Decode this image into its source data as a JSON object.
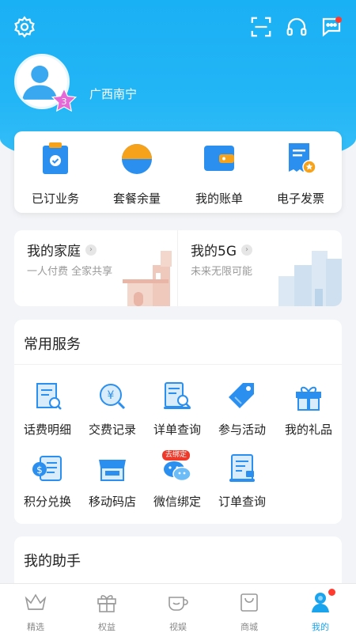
{
  "header": {
    "location": "广西南宁",
    "level": "3",
    "icons": [
      "gear-icon",
      "scan-icon",
      "headset-icon",
      "message-icon"
    ]
  },
  "quick_actions": [
    {
      "label": "已订业务",
      "icon": "clipboard-check-icon"
    },
    {
      "label": "套餐余量",
      "icon": "pie-chart-icon"
    },
    {
      "label": "我的账单",
      "icon": "wallet-icon"
    },
    {
      "label": "电子发票",
      "icon": "invoice-icon"
    }
  ],
  "family": {
    "left": {
      "title": "我的家庭",
      "subtitle": "一人付费 全家共享"
    },
    "right": {
      "title": "我的5G",
      "subtitle": "未来无限可能"
    }
  },
  "services": {
    "title": "常用服务",
    "items": [
      {
        "label": "话费明细",
        "icon": "bill-detail-icon"
      },
      {
        "label": "交费记录",
        "icon": "yuan-search-icon"
      },
      {
        "label": "详单查询",
        "icon": "document-search-icon"
      },
      {
        "label": "参与活动",
        "icon": "tag-icon"
      },
      {
        "label": "我的礼品",
        "icon": "gift-icon"
      },
      {
        "label": "积分兑换",
        "icon": "points-exchange-icon"
      },
      {
        "label": "移动码店",
        "icon": "store-icon"
      },
      {
        "label": "微信绑定",
        "icon": "wechat-icon",
        "badge": "去绑定"
      },
      {
        "label": "订单查询",
        "icon": "order-search-icon"
      }
    ]
  },
  "assistant": {
    "title": "我的助手"
  },
  "tabbar": [
    {
      "label": "精选",
      "icon": "crown-icon",
      "active": false
    },
    {
      "label": "权益",
      "icon": "gift-box-icon",
      "active": false
    },
    {
      "label": "视娱",
      "icon": "cup-icon",
      "active": false
    },
    {
      "label": "商城",
      "icon": "shopping-bag-icon",
      "active": false
    },
    {
      "label": "我的",
      "icon": "user-icon",
      "active": true
    }
  ],
  "colors": {
    "primary": "#1ab0f4",
    "accent_orange": "#f7a21b",
    "red_dot": "#ff3b30",
    "active_tab": "#1ba4ee"
  }
}
